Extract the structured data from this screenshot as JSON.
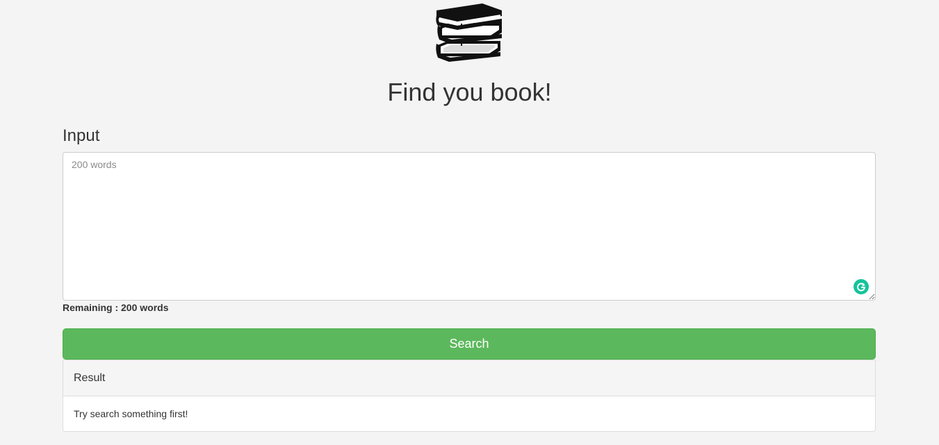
{
  "header": {
    "logo_icon": "books-stack-icon",
    "title": "Find you book!"
  },
  "form": {
    "input_label": "Input",
    "textarea_placeholder": "200 words",
    "textarea_value": "",
    "grammarly_icon": "grammarly-icon",
    "remaining_text": "Remaining : 200 words",
    "search_label": "Search"
  },
  "result": {
    "heading": "Result",
    "body_text": "Try search something first!"
  },
  "colors": {
    "background": "#f4f4f4",
    "search_button": "#5cb85c",
    "grammarly": "#15c39a"
  }
}
